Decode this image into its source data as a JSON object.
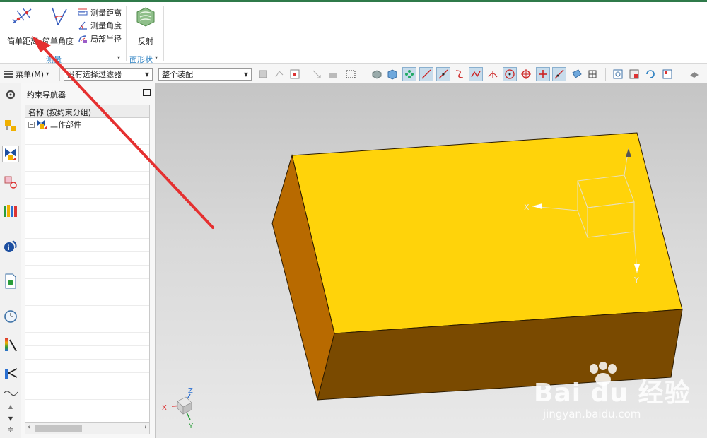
{
  "ribbon": {
    "simple_distance": "简单距离",
    "simple_angle": "简单角度",
    "measure_distance": "测量距离",
    "measure_angle": "测量角度",
    "local_radius": "局部半径",
    "measure_group": "测量",
    "reflect": "反射",
    "face_shape_group": "面形状"
  },
  "toolbar": {
    "menu_label": "菜单(M)",
    "selection_filter": "没有选择过滤器",
    "assembly_scope": "整个装配"
  },
  "navigator": {
    "title": "约束导航器",
    "column_header": "名称 (按约束分组)",
    "root_item": "工作部件"
  },
  "viewport": {
    "axis_labels": {
      "x": "X",
      "y": "Y",
      "z": "Z"
    },
    "colors": {
      "top_face": "#ffd30a",
      "left_face": "#b86a00",
      "front_face": "#7a4a00",
      "annotation_arrow": "#e53030"
    }
  },
  "watermark": {
    "brand": "Bai du 经验",
    "url": "jingyan.baidu.com"
  }
}
